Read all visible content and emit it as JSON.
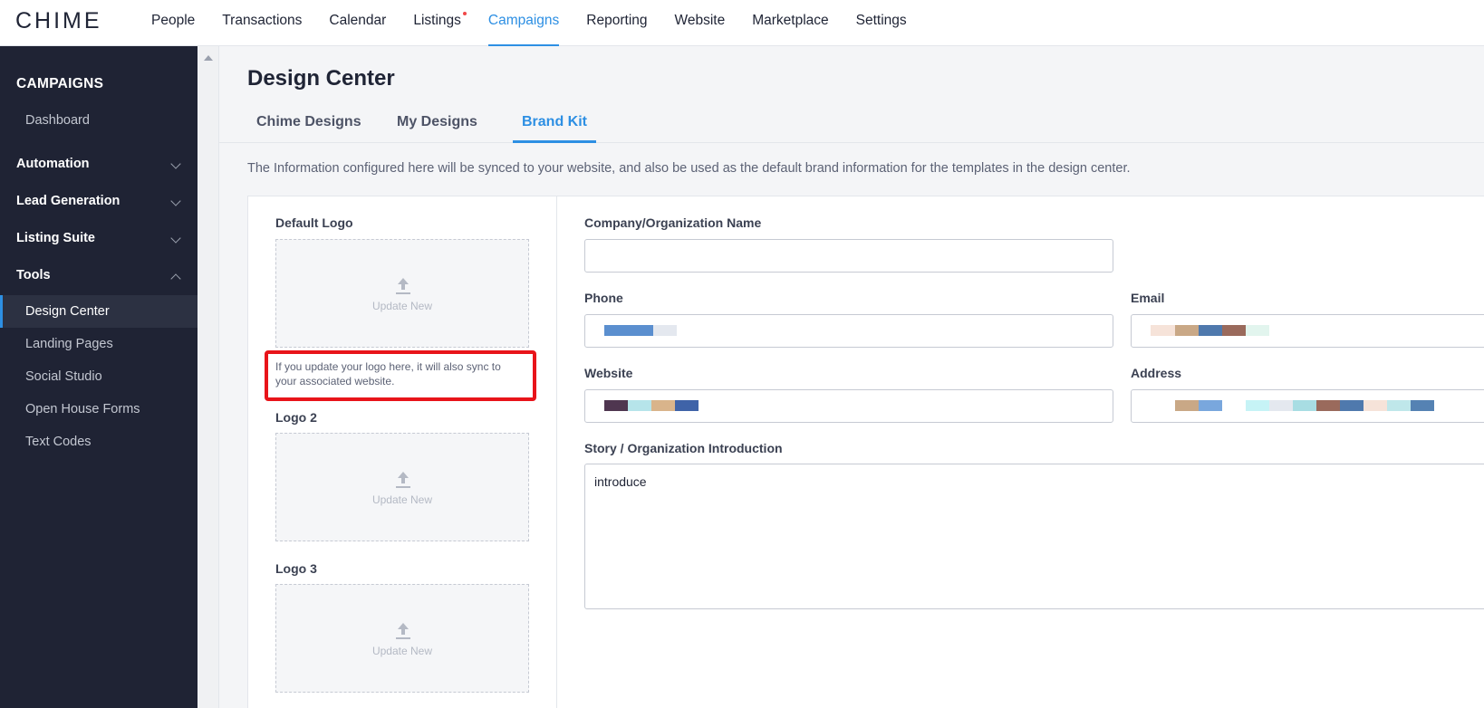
{
  "app": {
    "logo_text": "CHIME",
    "nav": [
      {
        "label": "People",
        "active": false,
        "dot": false
      },
      {
        "label": "Transactions",
        "active": false,
        "dot": false
      },
      {
        "label": "Calendar",
        "active": false,
        "dot": false
      },
      {
        "label": "Listings",
        "active": false,
        "dot": true
      },
      {
        "label": "Campaigns",
        "active": true,
        "dot": false
      },
      {
        "label": "Reporting",
        "active": false,
        "dot": false
      },
      {
        "label": "Website",
        "active": false,
        "dot": false
      },
      {
        "label": "Marketplace",
        "active": false,
        "dot": false
      },
      {
        "label": "Settings",
        "active": false,
        "dot": false
      }
    ]
  },
  "sidebar": {
    "title": "CAMPAIGNS",
    "dashboard": "Dashboard",
    "groups": [
      {
        "label": "Automation",
        "expanded": false
      },
      {
        "label": "Lead Generation",
        "expanded": false
      },
      {
        "label": "Listing Suite",
        "expanded": false
      },
      {
        "label": "Tools",
        "expanded": true
      }
    ],
    "tools_items": [
      {
        "label": "Design Center",
        "active": true
      },
      {
        "label": "Landing Pages",
        "active": false
      },
      {
        "label": "Social Studio",
        "active": false
      },
      {
        "label": "Open House Forms",
        "active": false
      },
      {
        "label": "Text Codes",
        "active": false
      }
    ]
  },
  "main": {
    "title": "Design Center",
    "tabs": [
      {
        "label": "Chime Designs",
        "active": false
      },
      {
        "label": "My Designs",
        "active": false
      },
      {
        "label": "Brand Kit",
        "active": true
      }
    ],
    "info": "The Information configured here will be synced to your website, and also be used as the default brand information for the templates in the design center."
  },
  "logos": {
    "default_label": "Default Logo",
    "upload_text": "Update New",
    "hint": "If you update your logo here, it will also sync to your associated website.",
    "logo2_label": "Logo 2",
    "logo3_label": "Logo 3"
  },
  "form": {
    "company_label": "Company/Organization Name",
    "company_value": "",
    "phone_label": "Phone",
    "email_label": "Email",
    "website_label": "Website",
    "address_label": "Address",
    "story_label": "Story / Organization Introduction",
    "story_value": "introduce"
  },
  "colors": {
    "accent": "#2d8fe3",
    "sidebar_bg": "#1f2334",
    "highlight": "#e8141a"
  },
  "icons": {
    "upload": "upload-arrow-icon",
    "chevron": "chevron-icon",
    "scroll_up": "caret-up-icon"
  }
}
